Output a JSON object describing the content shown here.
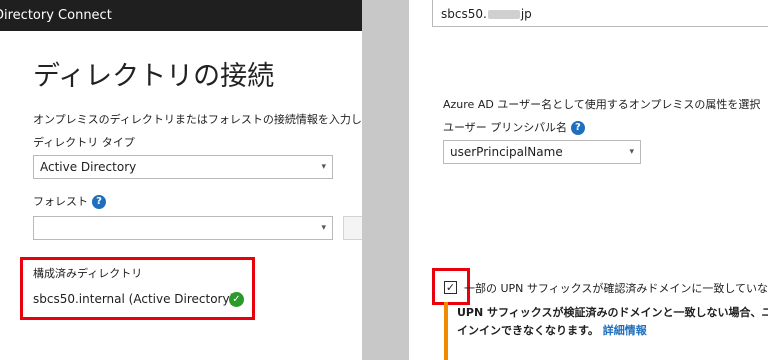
{
  "left_panel": {
    "window_title": "Directory Connect",
    "heading": "ディレクトリの接続",
    "description": "オンプレミスのディレクトリまたはフォレストの接続情報を入力してく",
    "directory_type_label": "ディレクトリ タイプ",
    "directory_type_value": "Active Directory",
    "forest_label": "フォレスト",
    "forest_value": "",
    "configured_label": "構成済みディレクトリ",
    "configured_item": "sbcs50.internal (Active Directory)"
  },
  "right_panel": {
    "domain_prefix": "sbcs50.",
    "domain_suffix": "jp",
    "attribute_desc": "Azure AD ユーザー名として使用するオンプレミスの属性を選択",
    "upn_label": "ユーザー プリンシパル名",
    "upn_value": "userPrincipalName",
    "checkbox_label": "一部の UPN サフィックスが確認済みドメインに一致していな",
    "checkbox_checked": true,
    "warning_line1": "UPN サフィックスが検証済みのドメインと一致しない場合、ユ",
    "warning_line2": "インインできなくなります。",
    "warning_link": "詳細情報"
  },
  "icons": {
    "help": "?",
    "dropdown": "▾",
    "check": "✓"
  },
  "colors": {
    "highlight_red": "#e8000d",
    "link_blue": "#1f6fbf",
    "warning_orange": "#f08a00",
    "success_green": "#2a9a2a"
  }
}
